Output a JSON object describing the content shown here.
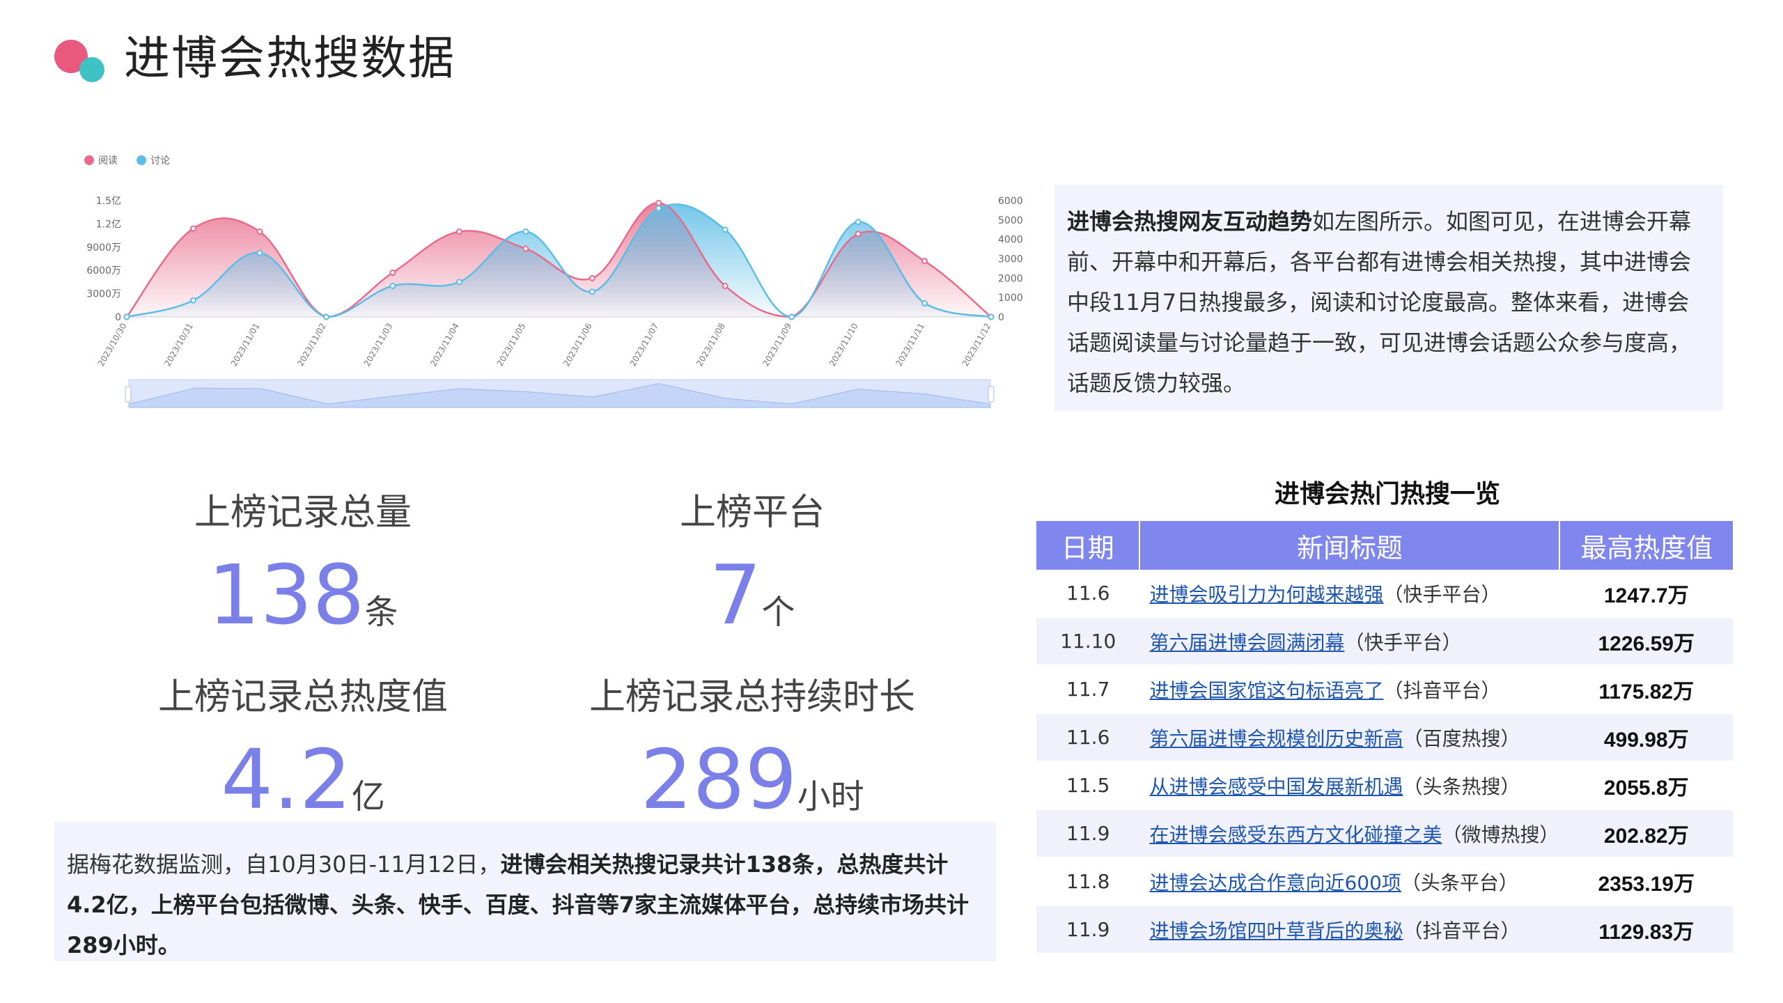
{
  "header": {
    "title": "进博会热搜数据"
  },
  "chart_data": {
    "type": "area",
    "legend": [
      "阅读",
      "讨论"
    ],
    "legend_position": "top-left",
    "x": [
      "2023/10/30",
      "2023/10/31",
      "2023/11/01",
      "2023/11/02",
      "2023/11/03",
      "2023/11/04",
      "2023/11/05",
      "2023/11/06",
      "2023/11/07",
      "2023/11/08",
      "2023/11/09",
      "2023/11/10",
      "2023/11/11",
      "2023/11/12"
    ],
    "y_left_ticks": [
      "0",
      "3000万",
      "6000万",
      "9000万",
      "1.2亿",
      "1.5亿"
    ],
    "y_right_ticks": [
      "0",
      "1000",
      "2000",
      "3000",
      "4000",
      "5000",
      "6000"
    ],
    "ylim_left": [
      0,
      150000000
    ],
    "ylim_right": [
      0,
      6000
    ],
    "series": [
      {
        "name": "阅读",
        "axis": "left",
        "color": "#e86b8b",
        "values": [
          0,
          114000000,
          110000000,
          0,
          57000000,
          110000000,
          88000000,
          50000000,
          147000000,
          40000000,
          0,
          107000000,
          72000000,
          0
        ]
      },
      {
        "name": "讨论",
        "axis": "right",
        "color": "#5bbde6",
        "values": [
          0,
          850,
          3300,
          0,
          1600,
          1800,
          4400,
          1300,
          5600,
          4500,
          0,
          4900,
          700,
          0
        ]
      }
    ],
    "grid": false,
    "zoom_slider": true
  },
  "description": {
    "bold_lead": "进博会热搜网友互动趋势",
    "text": "如左图所示。如图可见，在进博会开幕前、开幕中和开幕后，各平台都有进博会相关热搜，其中进博会中段11月7日热搜最多，阅读和讨论度最高。整体来看，进博会话题阅读量与讨论量趋于一致，可见进博会话题公众参与度高，话题反馈力较强。"
  },
  "stats": [
    {
      "label": "上榜记录总量",
      "value": "138",
      "unit": "条"
    },
    {
      "label": "上榜平台",
      "value": "7",
      "unit": "个"
    },
    {
      "label": "上榜记录总热度值",
      "value": "4.2",
      "unit": "亿"
    },
    {
      "label": "上榜记录总持续时长",
      "value": "289",
      "unit": "小时"
    }
  ],
  "summary": {
    "text_normal": "据梅花数据监测，自10月30日-11月12日，",
    "text_bold": "进博会相关热搜记录共计138条，总热度共计4.2亿，上榜平台包括微博、头条、快手、百度、抖音等7家主流媒体平台，总持续市场共计289小时。"
  },
  "table": {
    "title": "进博会热门热搜一览",
    "headers": [
      "日期",
      "新闻标题",
      "最高热度值"
    ],
    "rows": [
      {
        "date": "11.6",
        "title": "进博会吸引力为何越来越强",
        "platform": "（快手平台）",
        "value": "1247.7万"
      },
      {
        "date": "11.10",
        "title": "第六届进博会圆满闭幕",
        "platform": "（快手平台）",
        "value": "1226.59万"
      },
      {
        "date": "11.7",
        "title": "进博会国家馆这句标语亮了",
        "platform": "（抖音平台）",
        "value": "1175.82万"
      },
      {
        "date": "11.6",
        "title": "第六届进博会规模创历史新高",
        "platform": "（百度热搜）",
        "value": "499.98万"
      },
      {
        "date": "11.5",
        "title": "从进博会感受中国发展新机遇",
        "platform": "（头条热搜）",
        "value": "2055.8万"
      },
      {
        "date": "11.9",
        "title": "在进博会感受东西方文化碰撞之美",
        "platform": "（微博热搜）",
        "value": "202.82万"
      },
      {
        "date": "11.8",
        "title": "进博会达成合作意向近600项",
        "platform": "（头条平台）",
        "value": "2353.19万"
      },
      {
        "date": "11.9",
        "title": "进博会场馆四叶草背后的奥秘",
        "platform": "（抖音平台）",
        "value": "1129.83万"
      }
    ]
  }
}
